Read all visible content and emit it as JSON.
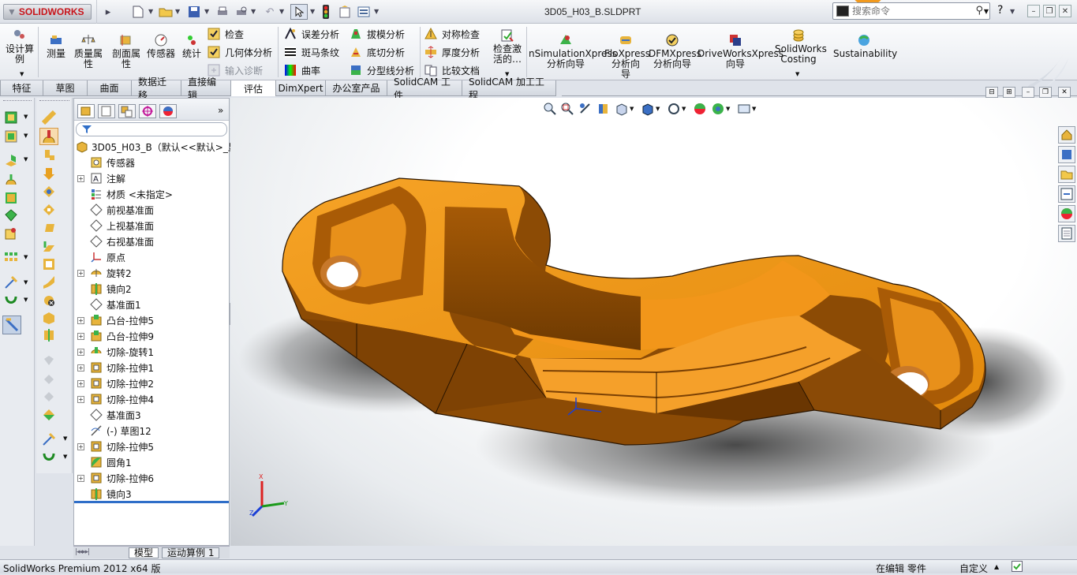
{
  "title_bar": {
    "logo_text": "SOLIDWORKS",
    "document_title": "3D05_H03_B.SLDPRT",
    "search_placeholder": "搜索命令",
    "help_label": "?",
    "window_buttons": [
      "minimize-icon",
      "restore-icon",
      "close-icon"
    ]
  },
  "command_manager": {
    "large_buttons": [
      {
        "label": "设计算例",
        "icon": "design-study-icon"
      },
      {
        "label": "测量",
        "icon": "measure-icon"
      },
      {
        "label": "质量属性",
        "icon": "mass-properties-icon"
      },
      {
        "label": "剖面属性",
        "icon": "section-properties-icon"
      },
      {
        "label": "传感器",
        "icon": "sensor-icon"
      },
      {
        "label": "统计",
        "icon": "statistics-icon"
      }
    ],
    "col1": [
      {
        "label": "检查",
        "icon": "check-icon",
        "enabled": true
      },
      {
        "label": "几何体分析",
        "icon": "geometry-analysis-icon",
        "enabled": true
      },
      {
        "label": "输入诊断",
        "icon": "import-diagnostics-icon",
        "enabled": false
      }
    ],
    "col2": [
      {
        "label": "误差分析",
        "icon": "deviation-analysis-icon"
      },
      {
        "label": "斑马条纹",
        "icon": "zebra-stripes-icon"
      },
      {
        "label": "曲率",
        "icon": "curvature-icon"
      }
    ],
    "col3": [
      {
        "label": "拔模分析",
        "icon": "draft-analysis-icon"
      },
      {
        "label": "底切分析",
        "icon": "undercut-analysis-icon"
      },
      {
        "label": "分型线分析",
        "icon": "parting-line-analysis-icon"
      }
    ],
    "col4": [
      {
        "label": "对称检查",
        "icon": "symmetry-check-icon"
      },
      {
        "label": "厚度分析",
        "icon": "thickness-analysis-icon"
      },
      {
        "label": "比较文档",
        "icon": "compare-documents-icon"
      }
    ],
    "check_active": {
      "label": "检查激活的…",
      "icon": "check-active-icon"
    },
    "xpress": [
      {
        "line1": "nSimulationXpress",
        "line2": "分析向导",
        "icon": "simulationxpress-icon"
      },
      {
        "line1": "FloXpress",
        "line2": "分析向",
        "line3": "导",
        "icon": "floxpress-icon"
      },
      {
        "line1": "DFMXpress",
        "line2": "分析向导",
        "icon": "dfmxpress-icon"
      },
      {
        "line1": "DriveWorksXpress",
        "line2": "向导",
        "icon": "driveworksxpress-icon"
      },
      {
        "line1": "SolidWorks",
        "line2": "Costing",
        "icon": "costing-icon"
      },
      {
        "line1": "Sustainability",
        "icon": "sustainability-icon"
      }
    ]
  },
  "tabs": [
    {
      "label": "特征",
      "active": false
    },
    {
      "label": "草图",
      "active": false
    },
    {
      "label": "曲面",
      "active": false
    },
    {
      "label": "数据迁移",
      "active": false
    },
    {
      "label": "直接编辑",
      "active": false
    },
    {
      "label": "评估",
      "active": true
    },
    {
      "label": "DimXpert",
      "active": false
    },
    {
      "label": "办公室产品",
      "active": false
    },
    {
      "label": "SolidCAM 工件",
      "active": false
    },
    {
      "label": "SolidCAM 加工工程",
      "active": false
    }
  ],
  "feature_tree": {
    "root": "3D05_H03_B（默认<<默认>_显",
    "expand_glyph": "+",
    "items": [
      {
        "label": "传感器",
        "icon": "sensor-folder-icon",
        "expandable": false
      },
      {
        "label": "注解",
        "icon": "annotations-icon",
        "expandable": true
      },
      {
        "label": "材质 <未指定>",
        "icon": "material-icon",
        "expandable": false
      },
      {
        "label": "前视基准面",
        "icon": "plane-icon",
        "expandable": false
      },
      {
        "label": "上视基准面",
        "icon": "plane-icon",
        "expandable": false
      },
      {
        "label": "右视基准面",
        "icon": "plane-icon",
        "expandable": false
      },
      {
        "label": "原点",
        "icon": "origin-icon",
        "expandable": false
      },
      {
        "label": "旋转2",
        "icon": "revolve-icon",
        "expandable": true
      },
      {
        "label": "镜向2",
        "icon": "mirror-icon",
        "expandable": false
      },
      {
        "label": "基准面1",
        "icon": "plane-icon",
        "expandable": false
      },
      {
        "label": "凸台-拉伸5",
        "icon": "boss-extrude-icon",
        "expandable": true
      },
      {
        "label": "凸台-拉伸9",
        "icon": "boss-extrude-icon",
        "expandable": true
      },
      {
        "label": "切除-旋转1",
        "icon": "cut-revolve-icon",
        "expandable": true
      },
      {
        "label": "切除-拉伸1",
        "icon": "cut-extrude-icon",
        "expandable": true
      },
      {
        "label": "切除-拉伸2",
        "icon": "cut-extrude-icon",
        "expandable": true
      },
      {
        "label": "切除-拉伸4",
        "icon": "cut-extrude-icon",
        "expandable": true
      },
      {
        "label": "基准面3",
        "icon": "plane-icon",
        "expandable": false
      },
      {
        "label": "(-) 草图12",
        "icon": "sketch-icon",
        "expandable": false
      },
      {
        "label": "切除-拉伸5",
        "icon": "cut-extrude-icon",
        "expandable": true
      },
      {
        "label": "圆角1",
        "icon": "fillet-icon",
        "expandable": false
      },
      {
        "label": "切除-拉伸6",
        "icon": "cut-extrude-icon",
        "expandable": true
      },
      {
        "label": "镜向3",
        "icon": "mirror-icon",
        "expandable": false
      }
    ]
  },
  "bottom_tabs": [
    {
      "label": "模型",
      "active": true
    },
    {
      "label": "运动算例 1",
      "active": false
    }
  ],
  "triad_labels": {
    "x": "X",
    "y": "Y",
    "z": "Z"
  },
  "status_bar": {
    "left": "SolidWorks Premium 2012 x64 版",
    "mode": "在编辑 零件",
    "units": "自定义",
    "units_arrow": "▲"
  },
  "colors": {
    "part_orange": "#f0940f",
    "part_shadow": "#8a4a06",
    "accent_blue": "#2f6ec8"
  }
}
